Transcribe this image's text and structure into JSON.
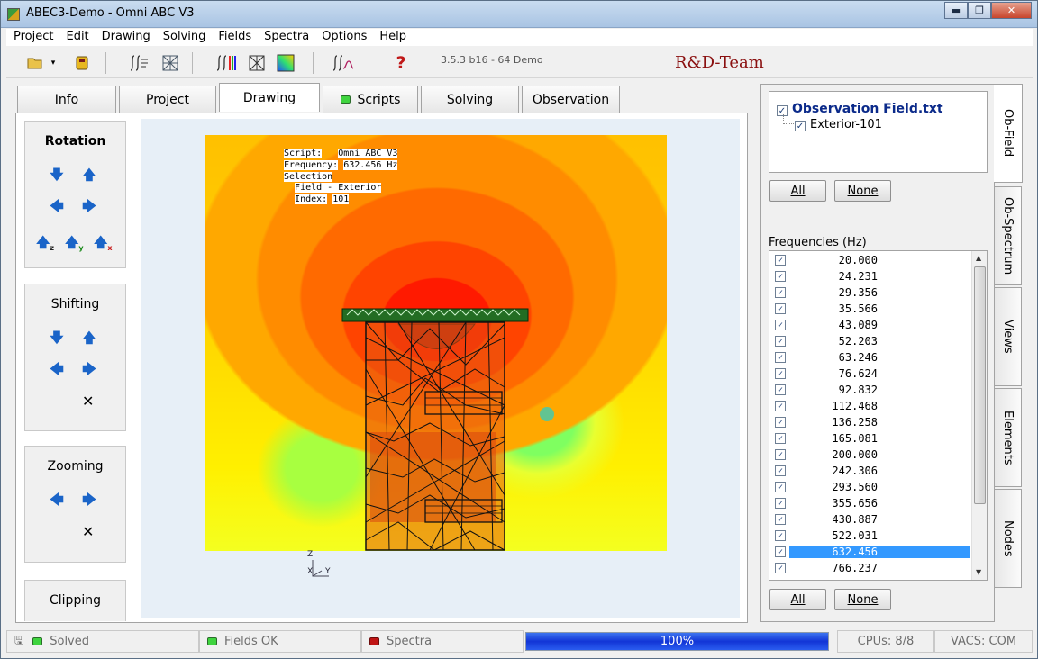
{
  "window": {
    "title": "ABEC3-Demo - Omni ABC V3",
    "minimize": "▬",
    "maximize": "❐",
    "close": "✕"
  },
  "menu": [
    "Project",
    "Edit",
    "Drawing",
    "Solving",
    "Fields",
    "Spectra",
    "Options",
    "Help"
  ],
  "toolbar": {
    "version": "3.5.3 b16 - 64 Demo",
    "team": "R&D-Team",
    "help_glyph": "?"
  },
  "tabs": [
    {
      "label": "Info"
    },
    {
      "label": "Project"
    },
    {
      "label": "Drawing",
      "active": true
    },
    {
      "label": "Scripts",
      "led": "green"
    },
    {
      "label": "Solving"
    },
    {
      "label": "Observation"
    }
  ],
  "controls": {
    "rotation": {
      "title": "Rotation",
      "axis_labels": [
        "z",
        "y",
        "x"
      ]
    },
    "shifting": {
      "title": "Shifting"
    },
    "zooming": {
      "title": "Zooming"
    },
    "clipping": {
      "title": "Clipping"
    },
    "reset_glyph": "✕"
  },
  "info": {
    "script_label": "Script:",
    "script_value": "Omni ABC V3",
    "freq_label": "Frequency:",
    "freq_value": "632.456 Hz",
    "selection": "Selection",
    "field": "Field - Exterior",
    "index_label": "Index:",
    "index_value": "101"
  },
  "axes": {
    "z": "Z",
    "x": "X",
    "y": "Y"
  },
  "obfield": {
    "root": "Observation Field.txt",
    "child": "Exterior-101",
    "all": "All",
    "none": "None"
  },
  "frequencies": {
    "label": "Frequencies  (Hz)",
    "values": [
      "20.000",
      "24.231",
      "29.356",
      "35.566",
      "43.089",
      "52.203",
      "63.246",
      "76.624",
      "92.832",
      "112.468",
      "136.258",
      "165.081",
      "200.000",
      "242.306",
      "293.560",
      "355.656",
      "430.887",
      "522.031",
      "632.456",
      "766.237"
    ],
    "selected_index": 18,
    "all": "All",
    "none": "None"
  },
  "side_tabs": [
    "Ob-Field",
    "Ob-Spectrum",
    "Views",
    "Elements",
    "Nodes"
  ],
  "status": {
    "solved": "Solved",
    "fields": "Fields OK",
    "spectra": "Spectra",
    "progress_label": "100%",
    "progress": 1.0,
    "cpus": "CPUs: 8/8",
    "vacs": "VACS: COM"
  },
  "colors": {
    "accent": "#1a64c8",
    "led_green": "#3fd43f",
    "led_red": "#c01515",
    "selection": "#3399ff",
    "progress": "#1235d6"
  }
}
